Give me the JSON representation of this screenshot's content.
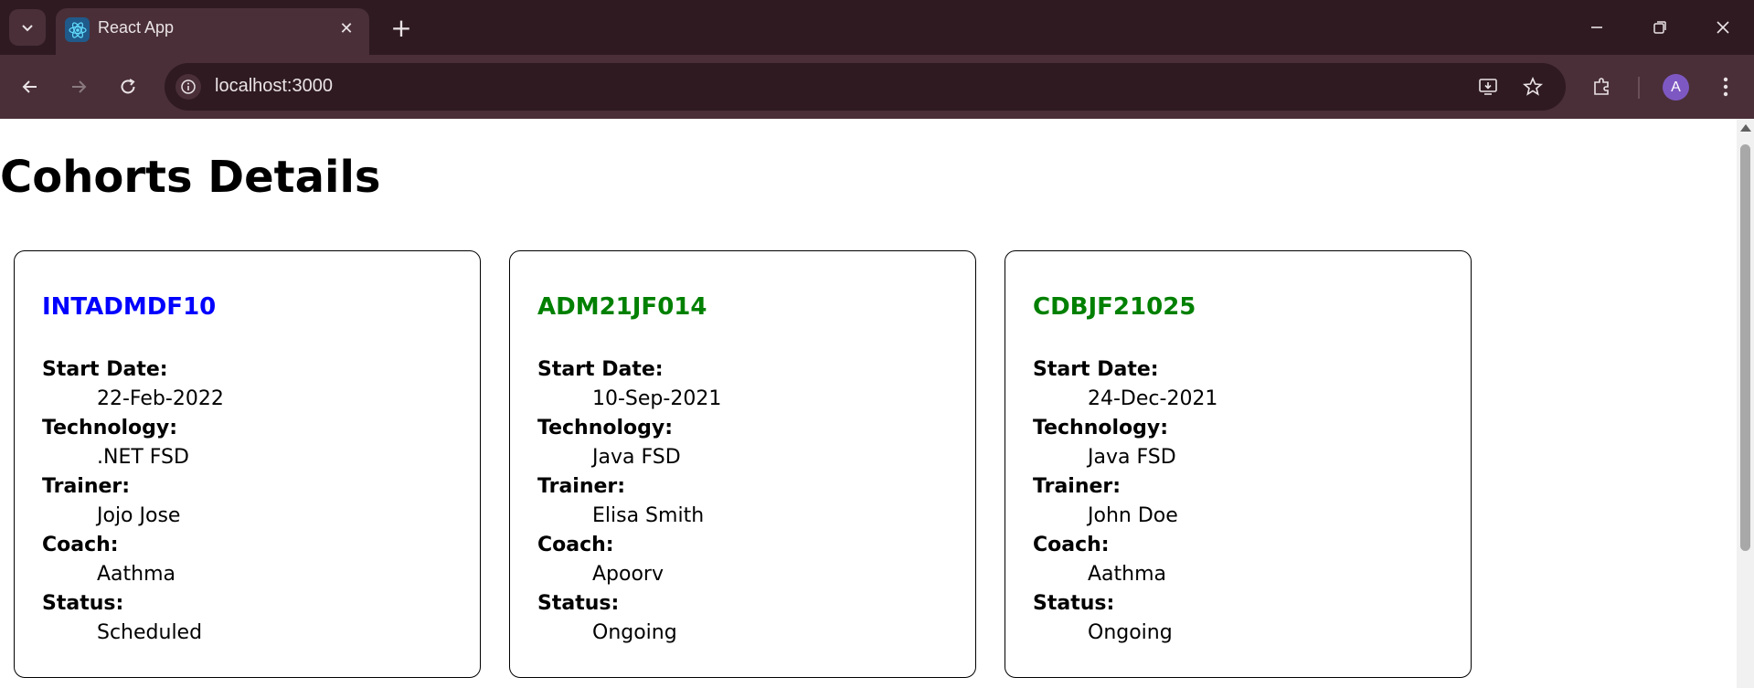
{
  "browser": {
    "tab_title": "React App",
    "tab_close": "✕",
    "new_tab": "+",
    "url": "localhost:3000",
    "avatar_letter": "A",
    "colors": {
      "frame": "#2f1a22",
      "toolbar": "#4a2f38",
      "avatar": "#7e58c2"
    }
  },
  "page": {
    "title": "Cohorts Details"
  },
  "labels": {
    "start_date": "Start Date:",
    "technology": "Technology:",
    "trainer": "Trainer:",
    "coach": "Coach:",
    "status": "Status:"
  },
  "cohorts": [
    {
      "code": "INTADMDF10",
      "code_color": "#0000ff",
      "start_date": "22-Feb-2022",
      "technology": ".NET FSD",
      "trainer": "Jojo Jose",
      "coach": "Aathma",
      "status": "Scheduled"
    },
    {
      "code": "ADM21JF014",
      "code_color": "#008000",
      "start_date": "10-Sep-2021",
      "technology": "Java FSD",
      "trainer": "Elisa Smith",
      "coach": "Apoorv",
      "status": "Ongoing"
    },
    {
      "code": "CDBJF21025",
      "code_color": "#008000",
      "start_date": "24-Dec-2021",
      "technology": "Java FSD",
      "trainer": "John Doe",
      "coach": "Aathma",
      "status": "Ongoing"
    }
  ]
}
